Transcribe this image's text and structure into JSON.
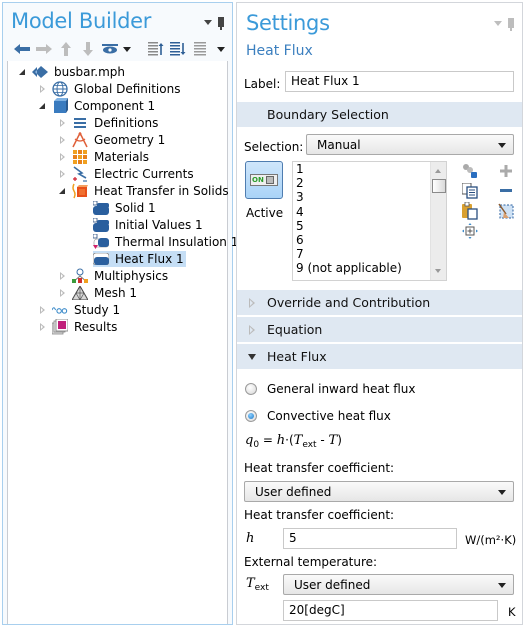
{
  "model_builder": {
    "title": "Model Builder",
    "toolbar": [
      {
        "name": "back",
        "icon": "arrow-left-icon"
      },
      {
        "name": "forward",
        "icon": "arrow-right-icon"
      },
      {
        "name": "up",
        "icon": "arrow-up-icon"
      },
      {
        "name": "down",
        "icon": "arrow-down-icon"
      },
      {
        "name": "show",
        "icon": "eye-icon"
      },
      {
        "name": "collapse-all",
        "icon": "list-collapse-icon"
      },
      {
        "name": "expand-all",
        "icon": "list-expand-icon"
      },
      {
        "name": "more",
        "icon": "list-icon"
      }
    ],
    "tree": [
      {
        "label": "busbar.mph",
        "icon": "model-icon",
        "level": 0,
        "state": "open"
      },
      {
        "label": "Global Definitions",
        "icon": "globe-icon",
        "level": 1,
        "state": "closed"
      },
      {
        "label": "Component 1",
        "icon": "component-icon",
        "level": 1,
        "state": "open"
      },
      {
        "label": "Definitions",
        "icon": "definitions-icon",
        "level": 2,
        "state": "closed"
      },
      {
        "label": "Geometry 1",
        "icon": "geometry-icon",
        "level": 2,
        "state": "closed"
      },
      {
        "label": "Materials",
        "icon": "materials-icon",
        "level": 2,
        "state": "closed"
      },
      {
        "label": "Electric Currents",
        "icon": "electric-currents-icon",
        "level": 2,
        "state": "closed"
      },
      {
        "label": "Heat Transfer in Solids",
        "icon": "heat-transfer-icon",
        "level": 2,
        "state": "open"
      },
      {
        "label": "Solid 1",
        "icon": "domain-node-icon",
        "level": 3,
        "state": "leaf"
      },
      {
        "label": "Initial Values 1",
        "icon": "domain-node-icon",
        "level": 3,
        "state": "leaf"
      },
      {
        "label": "Thermal Insulation 1",
        "icon": "boundary-node-icon",
        "level": 3,
        "state": "leaf"
      },
      {
        "label": "Heat Flux 1",
        "icon": "boundary-node-icon",
        "level": 3,
        "state": "leaf",
        "selected": true
      },
      {
        "label": "Multiphysics",
        "icon": "multiphysics-icon",
        "level": 2,
        "state": "closed"
      },
      {
        "label": "Mesh 1",
        "icon": "mesh-icon",
        "level": 2,
        "state": "closed"
      },
      {
        "label": "Study 1",
        "icon": "study-icon",
        "level": 1,
        "state": "closed"
      },
      {
        "label": "Results",
        "icon": "results-icon",
        "level": 1,
        "state": "closed"
      }
    ]
  },
  "settings": {
    "title": "Settings",
    "subtitle": "Heat Flux",
    "label_caption": "Label:",
    "label_value": "Heat Flux 1",
    "sections": {
      "boundary_selection": "Boundary Selection",
      "override": "Override and Contribution",
      "equation": "Equation",
      "heat_flux": "Heat Flux"
    },
    "selection_caption": "Selection:",
    "selection_value": "Manual",
    "active_switch": "ON",
    "active_label": "Active",
    "boundary_list": [
      "1",
      "2",
      "3",
      "4",
      "5",
      "6",
      "7",
      "9 (not applicable)"
    ],
    "radio_options": [
      {
        "label": "General inward heat flux",
        "checked": false
      },
      {
        "label": "Convective heat flux",
        "checked": true
      }
    ],
    "equation": {
      "lhs": "q",
      "lhs_sub": "0",
      "eq": " = ",
      "h": "h",
      "dot": "·",
      "open": "(",
      "T": "T",
      "T_sub": "ext",
      "minus": " - ",
      "T2": "T",
      "close": ")"
    },
    "htc_caption_1": "Heat transfer coefficient:",
    "htc_combo": "User defined",
    "htc_caption_2": "Heat transfer coefficient:",
    "h_symbol": "h",
    "h_value": "5",
    "h_unit": "W/(m²·K)",
    "ext_temp_caption": "External temperature:",
    "text_symbol": "T",
    "text_symbol_sub": "ext",
    "text_combo": "User defined",
    "text_value": "20[degC]",
    "text_unit": "K"
  }
}
